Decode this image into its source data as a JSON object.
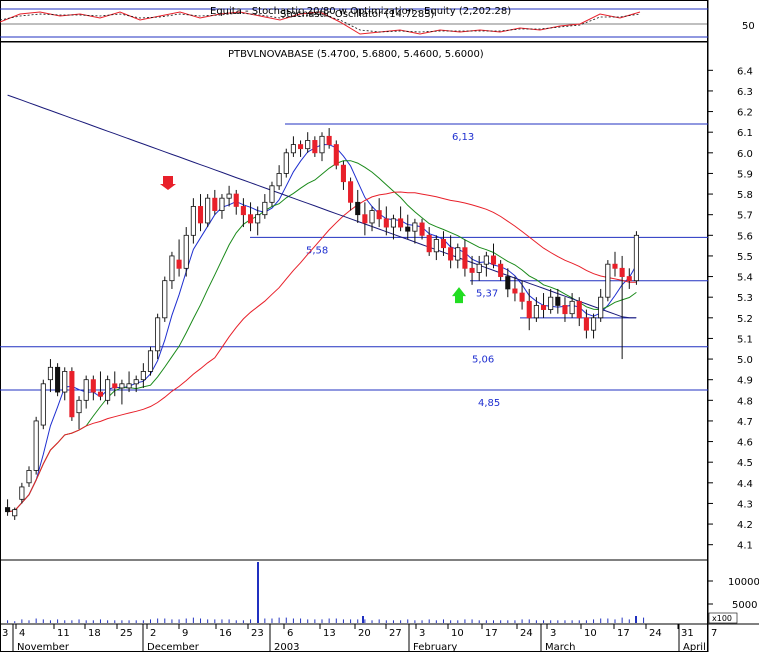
{
  "top_panel": {
    "title": "Equita - Stochastic 20/80 w Optimization - Equity (2,202.28)",
    "overlay_title": "Stochastic Oscillator (14.7283)",
    "scale_label": "50"
  },
  "main_panel": {
    "title": "PTBVLNOVABASE (5.4700, 5.6800, 5.4600, 5.6000)"
  },
  "volume_panel": {
    "ticks": [
      "10000",
      "5000"
    ],
    "multiplier": "x100"
  },
  "chart_data": {
    "type": "candlestick",
    "title": "PTBVLNOVABASE (5.4700, 5.6800, 5.4600, 5.6000)",
    "y_ticks": [
      "6.4",
      "6.3",
      "6.2",
      "6.1",
      "6.0",
      "5.9",
      "5.8",
      "5.7",
      "5.6",
      "5.5",
      "5.4",
      "5.3",
      "5.2",
      "5.1",
      "5.0",
      "4.9",
      "4.8",
      "4.7",
      "4.6",
      "4.5",
      "4.4",
      "4.3",
      "4.2",
      "4.1"
    ],
    "ylim": [
      4.05,
      6.45
    ],
    "x_day_ticks": [
      "3",
      "4",
      "11",
      "18",
      "25",
      "2",
      "9",
      "16",
      "23",
      "6",
      "13",
      "20",
      "27",
      "3",
      "10",
      "17",
      "24",
      "3",
      "10",
      "17",
      "24",
      "31",
      "7"
    ],
    "x_month_labels": [
      "November",
      "December",
      "2003",
      "February",
      "March",
      "April"
    ],
    "horizontal_levels": [
      {
        "label": "6,13",
        "value": 6.14
      },
      {
        "label": "5,58",
        "value": 5.59
      },
      {
        "label": "5,37",
        "value": 5.38
      },
      {
        "label": "5,06",
        "value": 5.06
      },
      {
        "label": "4,85",
        "value": 4.85
      }
    ],
    "annotations": [
      {
        "type": "sell-arrow",
        "color": "#e8202a",
        "date_index": 24,
        "price": 5.78
      },
      {
        "type": "buy-arrow",
        "color": "#22dd22",
        "date_index": 86,
        "price": 5.36
      }
    ],
    "candles": [
      [
        4.28,
        4.32,
        4.24,
        4.26
      ],
      [
        4.24,
        4.28,
        4.22,
        4.27
      ],
      [
        4.32,
        4.4,
        4.3,
        4.38
      ],
      [
        4.4,
        4.48,
        4.38,
        4.46
      ],
      [
        4.46,
        4.72,
        4.44,
        4.7
      ],
      [
        4.68,
        4.9,
        4.66,
        4.88
      ],
      [
        4.9,
        5.0,
        4.84,
        4.96
      ],
      [
        4.96,
        4.98,
        4.82,
        4.84
      ],
      [
        4.84,
        4.96,
        4.8,
        4.94
      ],
      [
        4.94,
        4.96,
        4.7,
        4.72
      ],
      [
        4.74,
        4.82,
        4.66,
        4.8
      ],
      [
        4.8,
        4.92,
        4.76,
        4.9
      ],
      [
        4.9,
        4.92,
        4.8,
        4.84
      ],
      [
        4.84,
        4.94,
        4.8,
        4.82
      ],
      [
        4.8,
        4.92,
        4.78,
        4.9
      ],
      [
        4.88,
        4.94,
        4.82,
        4.86
      ],
      [
        4.86,
        4.9,
        4.78,
        4.88
      ],
      [
        4.86,
        4.94,
        4.84,
        4.88
      ],
      [
        4.88,
        4.92,
        4.84,
        4.9
      ],
      [
        4.9,
        4.98,
        4.86,
        4.94
      ],
      [
        4.94,
        5.06,
        4.92,
        5.04
      ],
      [
        5.04,
        5.22,
        5.0,
        5.2
      ],
      [
        5.2,
        5.4,
        5.18,
        5.38
      ],
      [
        5.38,
        5.52,
        5.34,
        5.5
      ],
      [
        5.48,
        5.58,
        5.4,
        5.44
      ],
      [
        5.44,
        5.64,
        5.4,
        5.6
      ],
      [
        5.6,
        5.78,
        5.56,
        5.74
      ],
      [
        5.74,
        5.8,
        5.62,
        5.66
      ],
      [
        5.66,
        5.8,
        5.64,
        5.78
      ],
      [
        5.78,
        5.82,
        5.7,
        5.72
      ],
      [
        5.72,
        5.8,
        5.68,
        5.78
      ],
      [
        5.78,
        5.84,
        5.74,
        5.8
      ],
      [
        5.8,
        5.82,
        5.7,
        5.74
      ],
      [
        5.74,
        5.78,
        5.64,
        5.7
      ],
      [
        5.7,
        5.76,
        5.62,
        5.66
      ],
      [
        5.66,
        5.74,
        5.6,
        5.7
      ],
      [
        5.7,
        5.8,
        5.68,
        5.76
      ],
      [
        5.76,
        5.86,
        5.74,
        5.84
      ],
      [
        5.84,
        5.94,
        5.82,
        5.9
      ],
      [
        5.9,
        6.02,
        5.88,
        6.0
      ],
      [
        6.0,
        6.08,
        5.98,
        6.04
      ],
      [
        6.04,
        6.06,
        5.98,
        6.02
      ],
      [
        6.02,
        6.1,
        6.0,
        6.06
      ],
      [
        6.06,
        6.08,
        5.98,
        6.0
      ],
      [
        6.0,
        6.1,
        5.96,
        6.08
      ],
      [
        6.08,
        6.12,
        6.02,
        6.04
      ],
      [
        6.04,
        6.06,
        5.92,
        5.94
      ],
      [
        5.94,
        5.96,
        5.82,
        5.86
      ],
      [
        5.86,
        5.88,
        5.72,
        5.76
      ],
      [
        5.76,
        5.82,
        5.66,
        5.7
      ],
      [
        5.7,
        5.76,
        5.6,
        5.66
      ],
      [
        5.66,
        5.74,
        5.62,
        5.72
      ],
      [
        5.72,
        5.78,
        5.64,
        5.68
      ],
      [
        5.68,
        5.74,
        5.6,
        5.64
      ],
      [
        5.64,
        5.7,
        5.58,
        5.68
      ],
      [
        5.68,
        5.74,
        5.62,
        5.64
      ],
      [
        5.64,
        5.7,
        5.58,
        5.62
      ],
      [
        5.62,
        5.68,
        5.56,
        5.66
      ],
      [
        5.66,
        5.68,
        5.58,
        5.6
      ],
      [
        5.6,
        5.64,
        5.5,
        5.52
      ],
      [
        5.52,
        5.6,
        5.48,
        5.58
      ],
      [
        5.58,
        5.62,
        5.5,
        5.54
      ],
      [
        5.54,
        5.6,
        5.44,
        5.48
      ],
      [
        5.48,
        5.56,
        5.44,
        5.54
      ],
      [
        5.54,
        5.58,
        5.4,
        5.44
      ],
      [
        5.44,
        5.5,
        5.36,
        5.42
      ],
      [
        5.42,
        5.5,
        5.38,
        5.46
      ],
      [
        5.46,
        5.52,
        5.4,
        5.5
      ],
      [
        5.5,
        5.56,
        5.44,
        5.46
      ],
      [
        5.46,
        5.48,
        5.38,
        5.4
      ],
      [
        5.4,
        5.44,
        5.3,
        5.34
      ],
      [
        5.34,
        5.4,
        5.28,
        5.32
      ],
      [
        5.32,
        5.38,
        5.24,
        5.28
      ],
      [
        5.28,
        5.34,
        5.14,
        5.2
      ],
      [
        5.2,
        5.3,
        5.18,
        5.26
      ],
      [
        5.26,
        5.32,
        5.2,
        5.24
      ],
      [
        5.24,
        5.34,
        5.22,
        5.3
      ],
      [
        5.3,
        5.34,
        5.22,
        5.26
      ],
      [
        5.26,
        5.3,
        5.18,
        5.22
      ],
      [
        5.22,
        5.32,
        5.2,
        5.28
      ],
      [
        5.28,
        5.3,
        5.16,
        5.2
      ],
      [
        5.2,
        5.24,
        5.1,
        5.14
      ],
      [
        5.14,
        5.22,
        5.1,
        5.2
      ],
      [
        5.2,
        5.34,
        5.18,
        5.3
      ],
      [
        5.3,
        5.48,
        5.28,
        5.46
      ],
      [
        5.46,
        5.52,
        5.4,
        5.44
      ],
      [
        5.44,
        5.5,
        5.0,
        5.4
      ],
      [
        5.4,
        5.44,
        5.34,
        5.38
      ],
      [
        5.38,
        5.62,
        5.36,
        5.6
      ]
    ],
    "volume": [
      3,
      2,
      4,
      3,
      5,
      4,
      3,
      4,
      3,
      3,
      4,
      3,
      3,
      4,
      3,
      3,
      3,
      3,
      3,
      3,
      4,
      5,
      5,
      4,
      4,
      5,
      6,
      5,
      4,
      4,
      4,
      4,
      3,
      3,
      4,
      4,
      5,
      5,
      6,
      6,
      5,
      5,
      4,
      4,
      4,
      5,
      5,
      4,
      4,
      4,
      4,
      3,
      4,
      3,
      3,
      3,
      4,
      3,
      3,
      4,
      3,
      4,
      3,
      3,
      4,
      4,
      3,
      3,
      3,
      3,
      3,
      3,
      4,
      4,
      3,
      3,
      3,
      3,
      3,
      3,
      3,
      3,
      4,
      5,
      5,
      4,
      6,
      4,
      5,
      6
    ],
    "volume_spikes": [
      {
        "index": 56,
        "value": 12000
      },
      {
        "index": 70,
        "value": 600
      },
      {
        "index": 123,
        "value": 800
      }
    ],
    "series": [
      {
        "name": "",
        "color": "#1f2fd0",
        "type": "ma-fast"
      },
      {
        "name": "",
        "color": "#1a8a1a",
        "type": "ma-mid"
      },
      {
        "name": "",
        "color": "#e8202a",
        "type": "ma-slow"
      },
      {
        "name": "",
        "color": "#1a1a7a",
        "type": "ma-long"
      }
    ]
  },
  "colors": {
    "up_candle": "#ffffff",
    "down_candle": "#e8202a",
    "dark_candle": "#111111",
    "level_line": "#2030c0",
    "grid": "#000000"
  }
}
